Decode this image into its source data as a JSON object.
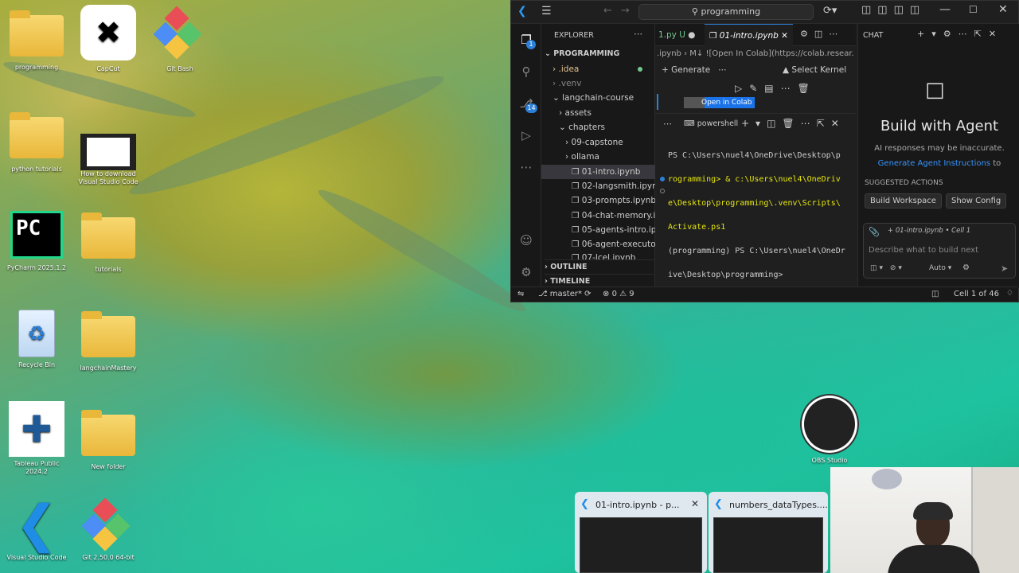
{
  "desktop_icons": [
    {
      "id": "programming",
      "label": "programming"
    },
    {
      "id": "capcut",
      "label": "CapCut"
    },
    {
      "id": "gitbash",
      "label": "Git Bash"
    },
    {
      "id": "python",
      "label": "python tutorials"
    },
    {
      "id": "howto",
      "label": "How to download Visual Studio Code"
    },
    {
      "id": "pycharm",
      "label": "PyCharm 2025.1.2"
    },
    {
      "id": "tutorials",
      "label": "tutorials"
    },
    {
      "id": "recycle",
      "label": "Recycle Bin"
    },
    {
      "id": "langchain",
      "label": "langchainMastery"
    },
    {
      "id": "tableau",
      "label": "Tableau Public 2024.2"
    },
    {
      "id": "newfolder",
      "label": "New folder"
    },
    {
      "id": "vscode",
      "label": "Visual Studio Code"
    },
    {
      "id": "git",
      "label": "Git 2.50.0 64-bit"
    },
    {
      "id": "obs",
      "label": "OBS Studio"
    }
  ],
  "vscode": {
    "search": "programming",
    "tabs": [
      {
        "label": "1.py U"
      },
      {
        "label": "01-intro.ipynb"
      }
    ],
    "explorer_title": "EXPLORER",
    "root": "PROGRAMMING",
    "tree": [
      ".idea",
      ".venv",
      "langchain-course",
      "assets",
      "chapters",
      "09-capstone",
      "ollama",
      "01-intro.ipynb",
      "02-langsmith.ipynb",
      "03-prompts.ipynb",
      "04-chat-memory.ip...",
      "05-agents-intro.ipy...",
      "06-agent-executor.i...",
      "07-lcel.ipynb"
    ],
    "outline": "OUTLINE",
    "timeline": "TIMELINE",
    "breadcrumb_file": ".ipynb",
    "breadcrumb_md": "M↓ ![Open In Colab](https://colab.resear...",
    "generate": "Generate",
    "select_kernel": "Select Kernel",
    "colab_badge": "Open in Colab",
    "terminal_tab": "powershell",
    "terminal_lines": [
      "PS C:\\Users\\nuel4\\OneDrive\\Desktop\\p",
      "rogramming> & c:\\Users\\nuel4\\OneDriv",
      "e\\Desktop\\programming\\.venv\\Scripts\\",
      "Activate.ps1",
      "(programming) PS C:\\Users\\nuel4\\OneDr",
      "ive\\Desktop\\programming>"
    ],
    "chat_title": "CHAT",
    "agent_heading": "Build with Agent",
    "agent_note": "AI responses may be inaccurate.",
    "agent_link": "Generate Agent Instructions",
    "agent_link_suffix": "to",
    "suggested": "SUGGESTED ACTIONS",
    "btn_workspace": "Build Workspace",
    "btn_config": "Show Config",
    "context_chip": "01-intro.ipynb • Cell 1",
    "chat_placeholder": "Describe what to build next",
    "mode": "Auto",
    "branch": "master*",
    "errors": "0",
    "warnings": "9",
    "cell_status": "Cell 1 of 46",
    "explorer_badge": "1",
    "scm_badge": "14"
  },
  "taskbar_previews": [
    {
      "label": "01-intro.ipynb - p..."
    },
    {
      "label": "numbers_dataTypes...."
    }
  ]
}
